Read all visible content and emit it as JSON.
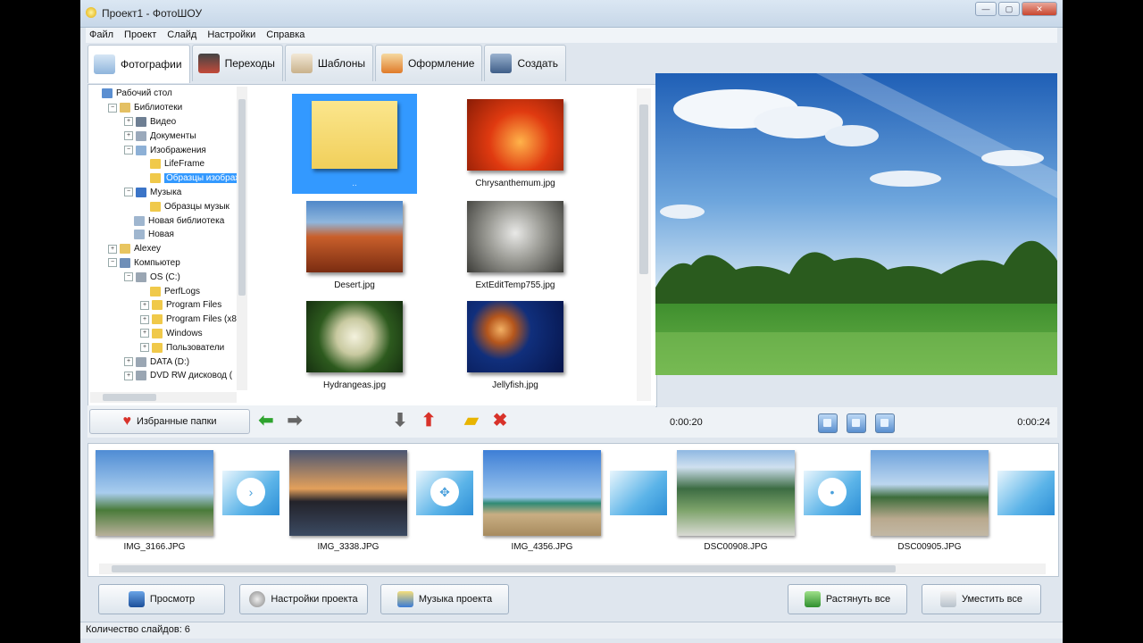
{
  "window": {
    "title": "Проект1 - ФотоШОУ",
    "buttons": [
      "—",
      "▢",
      "✕"
    ]
  },
  "menu": [
    "Файл",
    "Проект",
    "Слайд",
    "Настройки",
    "Справка"
  ],
  "tabs": [
    {
      "label": "Фотографии",
      "icon": "photos-icon",
      "color": "#8fb5dc"
    },
    {
      "label": "Переходы",
      "icon": "transitions-icon",
      "color": "#c34a3a"
    },
    {
      "label": "Шаблоны",
      "icon": "templates-icon",
      "color": "#c9b28c"
    },
    {
      "label": "Оформление",
      "icon": "design-icon",
      "color": "#e07b2a"
    },
    {
      "label": "Создать",
      "icon": "create-icon",
      "color": "#3f5e88"
    }
  ],
  "tree": [
    {
      "label": "Рабочий стол",
      "depth": 0,
      "exp": "",
      "color": "#5b8fd1"
    },
    {
      "label": "Библиотеки",
      "depth": 1,
      "exp": "−",
      "color": "#e4c063"
    },
    {
      "label": "Видео",
      "depth": 2,
      "exp": "+",
      "color": "#6e7f93"
    },
    {
      "label": "Документы",
      "depth": 2,
      "exp": "+",
      "color": "#9aa9bb"
    },
    {
      "label": "Изображения",
      "depth": 2,
      "exp": "−",
      "color": "#8db0d6"
    },
    {
      "label": "LifeFrame",
      "depth": 3,
      "exp": "",
      "color": "#f0c94a"
    },
    {
      "label": "Образцы изображ",
      "depth": 3,
      "exp": "",
      "color": "#f0c94a",
      "selected": true
    },
    {
      "label": "Музыка",
      "depth": 2,
      "exp": "−",
      "color": "#3b74c7"
    },
    {
      "label": "Образцы музык",
      "depth": 3,
      "exp": "",
      "color": "#f0c94a"
    },
    {
      "label": "Новая библиотека",
      "depth": 2,
      "exp": "",
      "color": "#9fb6cf"
    },
    {
      "label": "Новая",
      "depth": 2,
      "exp": "",
      "color": "#9fb6cf"
    },
    {
      "label": "Alexey",
      "depth": 1,
      "exp": "+",
      "color": "#e8c560"
    },
    {
      "label": "Компьютер",
      "depth": 1,
      "exp": "−",
      "color": "#6f8fb8"
    },
    {
      "label": "OS (C:)",
      "depth": 2,
      "exp": "−",
      "color": "#9aa6b3"
    },
    {
      "label": "PerfLogs",
      "depth": 3,
      "exp": "",
      "color": "#f0c94a"
    },
    {
      "label": "Program Files",
      "depth": 3,
      "exp": "+",
      "color": "#f0c94a"
    },
    {
      "label": "Program Files (x8",
      "depth": 3,
      "exp": "+",
      "color": "#f0c94a"
    },
    {
      "label": "Windows",
      "depth": 3,
      "exp": "+",
      "color": "#f0c94a"
    },
    {
      "label": "Пользователи",
      "depth": 3,
      "exp": "+",
      "color": "#f0c94a"
    },
    {
      "label": "DATA (D:)",
      "depth": 2,
      "exp": "+",
      "color": "#9aa6b3"
    },
    {
      "label": "DVD RW дисковод (",
      "depth": 2,
      "exp": "+",
      "color": "#9aa6b3"
    }
  ],
  "thumbnails": [
    {
      "caption": "..",
      "selected": true,
      "bg": "linear-gradient(#fbe68d,#f1cf5a)"
    },
    {
      "caption": "Chrysanthemum.jpg",
      "bg": "radial-gradient(circle at 55% 60%,#ffb34a,#e03a10 45%,#8a1c06)"
    },
    {
      "caption": "Desert.jpg",
      "bg": "linear-gradient(#4f88c9 0%,#8fb6dd 30%,#c95f2b 50%,#7a2c11 100%)"
    },
    {
      "caption": "ExtEditTemp755.jpg",
      "bg": "radial-gradient(circle at 50% 45%,#e9e9e7,#9a9a94 45%,#3c3c38)"
    },
    {
      "caption": "Hydrangeas.jpg",
      "bg": "radial-gradient(circle at 50% 50%,#f4f2de,#c8c9a0 30%,#2d5a1e 60%,#163010)"
    },
    {
      "caption": "Jellyfish.jpg",
      "bg": "radial-gradient(circle at 35% 40%,#f2b064,#b5561c 18%,#102f7c 40%,#06144a)"
    }
  ],
  "favorites_button": "Избранные папки",
  "timeline": {
    "start": "0:00:20",
    "end": "0:00:24"
  },
  "slides": [
    {
      "caption": "IMG_3166.JPG",
      "bg": "linear-gradient(#4f8cd4 0%,#a9cdee 50%,#4a7b3a 70%,#b8b09a 100%)"
    },
    {
      "caption": "IMG_3338.JPG",
      "bg": "linear-gradient(#4b5673 0%,#e3a05b 45%,#23232a 60%,#3b4a62 100%)"
    },
    {
      "caption": "IMG_4356.JPG",
      "bg": "linear-gradient(#3e7fd6 0%,#9cc6ee 55%,#2f8a74 62%,#c9ae83 75%,#a78b5e 100%)"
    },
    {
      "caption": "DSC00908.JPG",
      "bg": "linear-gradient(#8fb8e2 0%,#cfe0ef 20%,#3c6c43 45%,#7da36a 70%,#d9dad4 100%)"
    },
    {
      "caption": "DSC00905.JPG",
      "bg": "linear-gradient(#6ea3dc 0%,#bcd6ef 40%,#3d6d3b 55%,#b9a98e 80%,#c2b8a5 100%)"
    }
  ],
  "transitions": [
    {
      "glyph": "›"
    },
    {
      "glyph": "✥"
    },
    {
      "glyph": ""
    },
    {
      "glyph": "•"
    },
    {
      "glyph": ""
    }
  ],
  "bottom_buttons": {
    "preview": "Просмотр",
    "project_settings": "Настройки проекта",
    "project_music": "Музыка проекта",
    "stretch_all": "Растянуть все",
    "shrink_all": "Уместить все"
  },
  "status": "Количество слайдов: 6",
  "colors": {
    "selection": "#3399ff",
    "window_bg": "#dfe6ee",
    "accent_green": "#2ea32e",
    "accent_red": "#d8322a"
  }
}
